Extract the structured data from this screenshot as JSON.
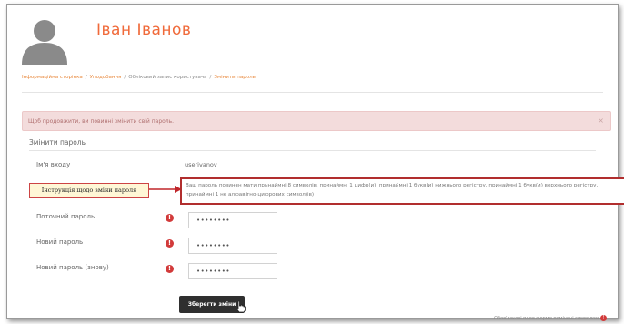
{
  "header": {
    "user_name": "Іван Іванов"
  },
  "breadcrumb": {
    "items": [
      "Інформаційна сторінка",
      "Уподобання",
      "Обліковий запис користувача",
      "Змінити пароль"
    ],
    "separator": "/"
  },
  "alert": {
    "message": "Щоб продовжити, ви повинні змінити свій пароль.",
    "close_glyph": "×"
  },
  "form": {
    "legend": "Змінити пароль",
    "username_label": "Ім'я входу",
    "username_value": "userivanov",
    "password_hint": "Ваш пароль повинен мати принаймні 8 символів, принаймні 1 цифр(и), принаймні 1 букв(и) нижнього регістру, принаймні 1 букв(и) верхнього регістру, принаймні 1 не алфавітно-цифрових символ(ів)",
    "current_password_label": "Поточний пароль",
    "current_password_value": "••••••••",
    "new_password_label": "Новий пароль",
    "new_password_value": "••••••••",
    "repeat_password_label": "Новий пароль (знову)",
    "repeat_password_value": "••••••••",
    "required_glyph": "!",
    "save_label": "Зберегти зміни"
  },
  "annotation": {
    "callout_text": "Інструкція щодо зміни пароля"
  },
  "footer": {
    "required_note": "Обов'язкові поля форми помічені символом"
  },
  "icons": {
    "avatar": "user-avatar-icon",
    "required": "exclamation-circle-icon",
    "cursor": "hand-pointer-icon",
    "close": "close-icon"
  },
  "colors": {
    "brand": "#f06a3a",
    "alert_bg": "#f3dcdc",
    "required": "#d23a3a",
    "annotation_border": "#b12e2e"
  }
}
